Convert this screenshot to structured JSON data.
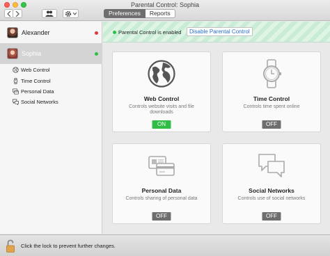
{
  "window": {
    "title": "Parental Control: Sophia",
    "tabs": [
      {
        "label": "Preferences",
        "active": true
      },
      {
        "label": "Reports",
        "active": false
      }
    ]
  },
  "sidebar": {
    "users": [
      {
        "name": "Alexander",
        "status_color": "#e0383e",
        "selected": false
      },
      {
        "name": "Sophia",
        "status_color": "#2fbf49",
        "selected": true
      }
    ],
    "items": [
      {
        "label": "Web Control",
        "icon": "globe-icon"
      },
      {
        "label": "Time Control",
        "icon": "watch-icon"
      },
      {
        "label": "Personal Data",
        "icon": "cards-icon"
      },
      {
        "label": "Social Networks",
        "icon": "chat-icon"
      }
    ]
  },
  "banner": {
    "status_text": "Parental Control is enabled",
    "button_label": "Disable Parental Control"
  },
  "cards": [
    {
      "title": "Web Control",
      "description": "Controls website visits and file downloads",
      "state": "ON",
      "icon": "globe-icon"
    },
    {
      "title": "Time Control",
      "description": "Controls time spent online",
      "state": "OFF",
      "icon": "watch-icon"
    },
    {
      "title": "Personal Data",
      "description": "Controls sharing of personal data",
      "state": "OFF",
      "icon": "cards-icon"
    },
    {
      "title": "Social Networks",
      "description": "Controls use of social networks",
      "state": "OFF",
      "icon": "chat-icon"
    }
  ],
  "footer": {
    "lock_text": "Click the lock to prevent further changes."
  },
  "colors": {
    "on": "#2fbd47",
    "off": "#6e6e6e",
    "link": "#2a6fc9"
  }
}
